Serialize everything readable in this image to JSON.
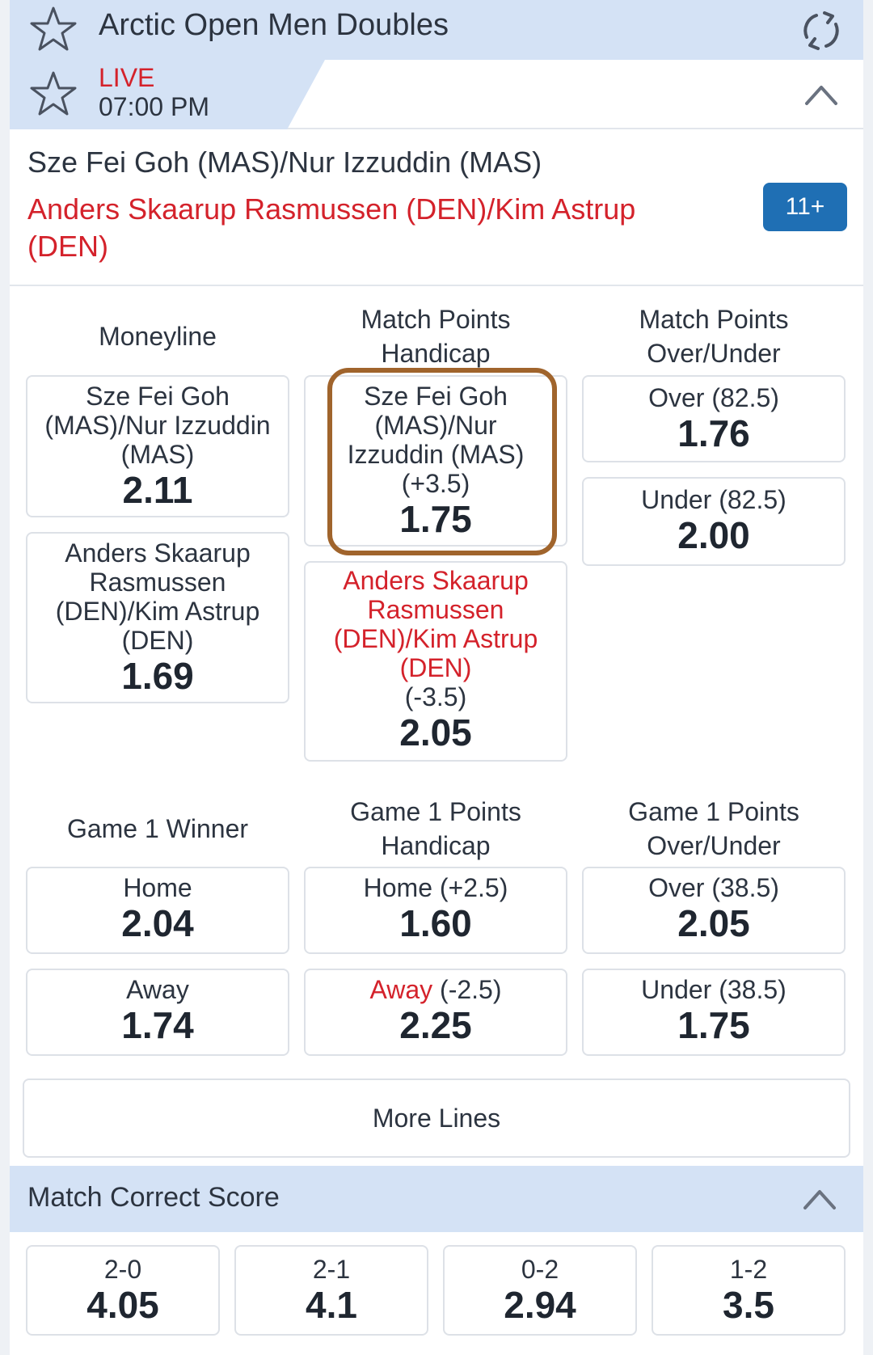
{
  "header": {
    "tournament_title": "Arctic Open Men Doubles"
  },
  "event": {
    "live_label": "LIVE",
    "time": "07:00 PM",
    "home_team": "Sze Fei Goh (MAS)/Nur Izzuddin (MAS)",
    "away_team": "Anders Skaarup Rasmussen (DEN)/Kim Astrup (DEN)",
    "more_markets_badge": "11+"
  },
  "markets": {
    "moneyline": {
      "title": "Moneyline",
      "home": {
        "label": "Sze Fei Goh (MAS)/Nur Izzuddin (MAS)",
        "price": "2.11"
      },
      "away": {
        "label": "Anders Skaarup Rasmussen (DEN)/Kim Astrup (DEN)",
        "price": "1.69"
      }
    },
    "match_handicap": {
      "title": "Match Points Handicap",
      "home": {
        "label": "Sze Fei Goh (MAS)/Nur Izzuddin (MAS)",
        "line": "(+3.5)",
        "price": "1.75"
      },
      "away": {
        "label": "Anders Skaarup Rasmussen (DEN)/Kim Astrup (DEN)",
        "line": "(-3.5)",
        "price": "2.05"
      }
    },
    "match_total": {
      "title": "Match Points Over/Under",
      "over": {
        "label": "Over",
        "line": "(82.5)",
        "price": "1.76"
      },
      "under": {
        "label": "Under",
        "line": "(82.5)",
        "price": "2.00"
      }
    },
    "game1_winner": {
      "title": "Game 1 Winner",
      "home": {
        "label": "Home",
        "price": "2.04"
      },
      "away": {
        "label": "Away",
        "price": "1.74"
      }
    },
    "game1_handicap": {
      "title": "Game 1 Points Handicap",
      "home": {
        "label": "Home",
        "line": "(+2.5)",
        "price": "1.60"
      },
      "away": {
        "label": "Away",
        "line": "(-2.5)",
        "price": "2.25"
      }
    },
    "game1_total": {
      "title": "Game 1 Points Over/Under",
      "over": {
        "label": "Over",
        "line": "(38.5)",
        "price": "2.05"
      },
      "under": {
        "label": "Under",
        "line": "(38.5)",
        "price": "1.75"
      }
    }
  },
  "more_lines_label": "More Lines",
  "correct_score": {
    "title": "Match Correct Score",
    "options": [
      {
        "score": "2-0",
        "price": "4.05"
      },
      {
        "score": "2-1",
        "price": "4.1"
      },
      {
        "score": "0-2",
        "price": "2.94"
      },
      {
        "score": "1-2",
        "price": "3.5"
      }
    ]
  },
  "colors": {
    "header_bg": "#d4e2f5",
    "live_red": "#d4222b",
    "badge_blue": "#1f6fb4",
    "highlight_border": "#a0642c"
  }
}
